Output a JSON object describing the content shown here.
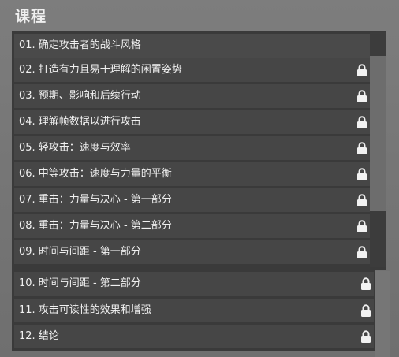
{
  "section_title": "课程",
  "lessons": [
    {
      "label": "01. 确定攻击者的战斗风格",
      "locked": false
    },
    {
      "label": "02. 打造有力且易于理解的闲置姿势",
      "locked": true
    },
    {
      "label": "03. 预期、影响和后续行动",
      "locked": true
    },
    {
      "label": "04. 理解帧数据以进行攻击",
      "locked": true
    },
    {
      "label": "05. 轻攻击：速度与效率",
      "locked": true
    },
    {
      "label": "06. 中等攻击：速度与力量的平衡",
      "locked": true
    },
    {
      "label": "07. 重击：力量与决心 - 第一部分",
      "locked": true
    },
    {
      "label": "08. 重击：力量与决心 - 第二部分",
      "locked": true
    },
    {
      "label": "09. 时间与间距 - 第一部分",
      "locked": true
    },
    {
      "label": "10. 时间与间距 - 第二部分",
      "locked": true
    },
    {
      "label": "11. 攻击可读性的效果和增强",
      "locked": true
    },
    {
      "label": "12. 结论",
      "locked": true
    }
  ],
  "icons": {
    "lock": "lock-icon"
  }
}
